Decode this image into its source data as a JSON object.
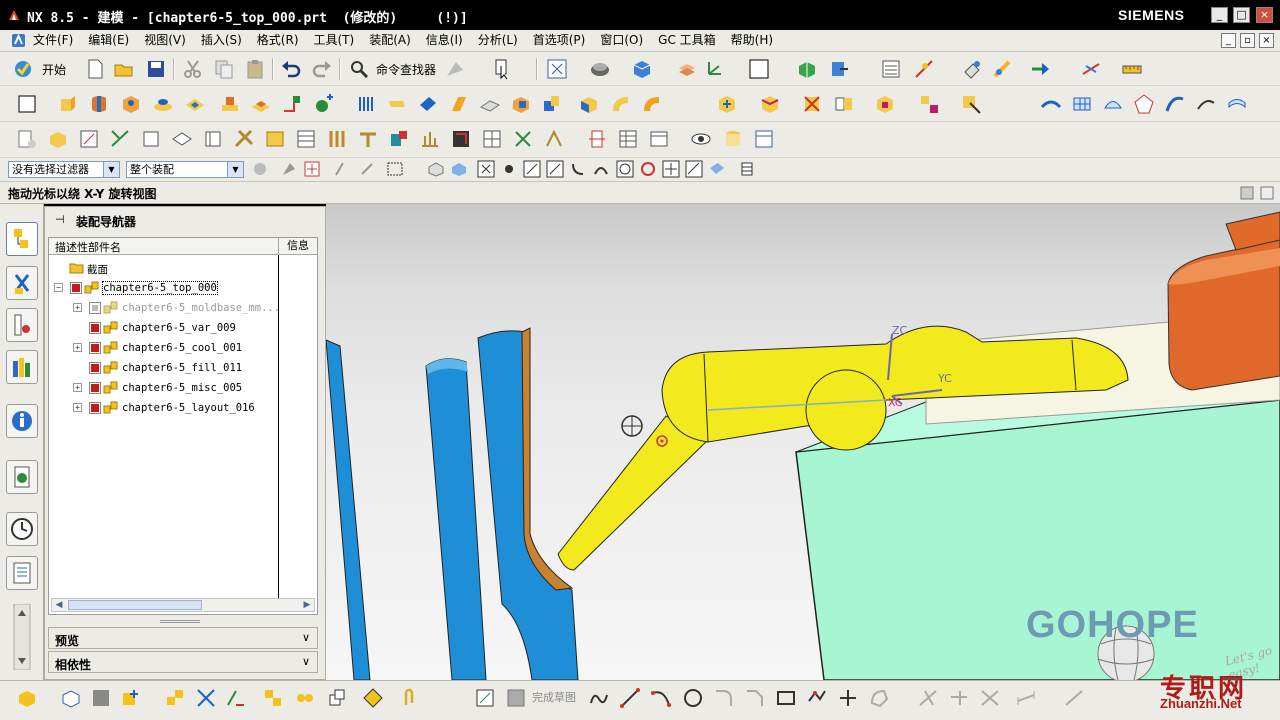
{
  "window": {
    "title": "NX 8.5 - 建模 - [chapter6-5_top_000.prt  (修改的)     (!)]",
    "brand": "SIEMENS",
    "controls": [
      "_",
      "□",
      "×"
    ]
  },
  "menubar": {
    "items": [
      "文件(F)",
      "编辑(E)",
      "视图(V)",
      "插入(S)",
      "格式(R)",
      "工具(T)",
      "装配(A)",
      "信息(I)",
      "分析(L)",
      "首选项(P)",
      "窗口(O)",
      "GC 工具箱",
      "帮助(H)"
    ],
    "mdi_controls": [
      "_",
      "▫",
      "×"
    ]
  },
  "toolbar": {
    "start_label": "开始",
    "finder_label": "命令查找器"
  },
  "filterbar": {
    "selection_filter": "没有选择过滤器",
    "assembly_scope": "整个装配"
  },
  "cue_line": "拖动光标以绕 X-Y 旋转视图",
  "navigator": {
    "title": "装配导航器",
    "col_name": "描述性部件名",
    "col_info": "信息",
    "rows": [
      {
        "label": "截面",
        "type": "folder"
      },
      {
        "label": "chapter6-5_top_000",
        "type": "root"
      },
      {
        "label": "chapter6-5_moldbase_mm...",
        "type": "child",
        "expand": "+",
        "state": "grey"
      },
      {
        "label": "chapter6-5_var_009",
        "type": "child",
        "expand": "",
        "state": "on"
      },
      {
        "label": "chapter6-5_cool_001",
        "type": "child",
        "expand": "+",
        "state": "on"
      },
      {
        "label": "chapter6-5_fill_011",
        "type": "child",
        "expand": "",
        "state": "on"
      },
      {
        "label": "chapter6-5_misc_005",
        "type": "child",
        "expand": "+",
        "state": "on"
      },
      {
        "label": "chapter6-5_layout_016",
        "type": "child",
        "expand": "+",
        "state": "on"
      }
    ],
    "panels": [
      "预览",
      "相依性"
    ]
  },
  "viewport": {
    "axes": {
      "zc": "ZC",
      "yc": "YC",
      "xc": "XC"
    },
    "watermark": "GOHOPE",
    "watermark_tagline": "Let's go easy!"
  },
  "bottombar": {
    "sketch_done": "完成草图"
  },
  "site": {
    "name_cn": "专职网",
    "url": "Zhuanzhi.Net"
  },
  "colors": {
    "titlebar": "#000000",
    "chrome": "#ecebe6",
    "runner_yellow": "#f2ea1c",
    "pipe_blue": "#1e8fd6",
    "plate_mint": "#a8f5d4",
    "insert_orange": "#e0682a",
    "watermark": "#6d9bb4",
    "site_red": "#b21a18"
  }
}
